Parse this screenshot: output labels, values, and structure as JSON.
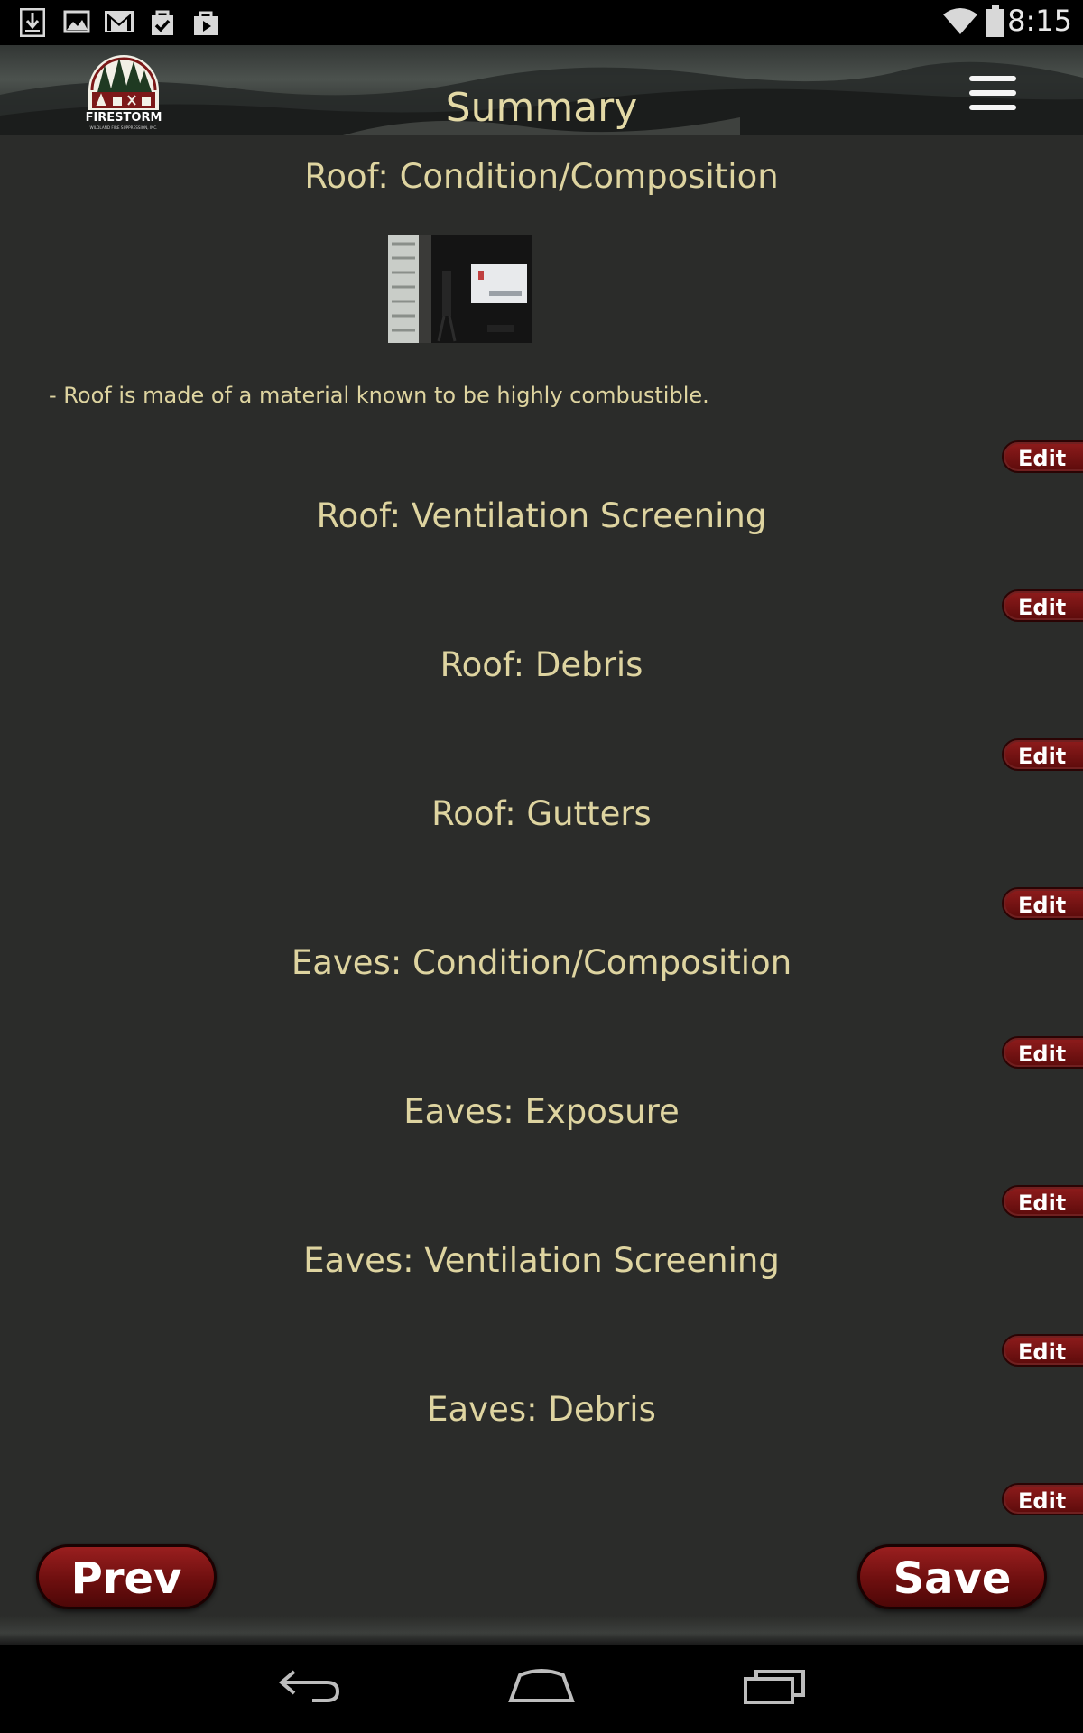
{
  "status_bar": {
    "time": "8:15",
    "left_icons": [
      "download-icon",
      "image-icon",
      "gmail-icon",
      "tasks-icon",
      "play-store-icon"
    ],
    "right_icons": [
      "wifi-icon",
      "battery-icon"
    ]
  },
  "header": {
    "title": "Summary",
    "logo_text": "FIRESTORM",
    "logo_subtext": "WILDLAND FIRE SUPPRESSION, INC."
  },
  "sections": [
    {
      "title": "Roof: Condition/Composition",
      "note": "- Roof is made of a material known to be highly combustible.",
      "has_photo": true,
      "edit_label": "Edit"
    },
    {
      "title": "Roof: Ventilation Screening",
      "edit_label": "Edit"
    },
    {
      "title": "Roof: Debris",
      "edit_label": "Edit"
    },
    {
      "title": "Roof: Gutters",
      "edit_label": "Edit"
    },
    {
      "title": "Eaves: Condition/Composition",
      "edit_label": "Edit"
    },
    {
      "title": "Eaves: Exposure",
      "edit_label": "Edit"
    },
    {
      "title": "Eaves: Ventilation Screening",
      "edit_label": "Edit"
    },
    {
      "title": "Eaves: Debris",
      "edit_label": "Edit"
    }
  ],
  "footer": {
    "prev_label": "Prev",
    "save_label": "Save"
  },
  "nav_bar": [
    "back-icon",
    "home-icon",
    "recents-icon"
  ],
  "colors": {
    "background": "#2b2c2a",
    "text": "#ded4a0",
    "button": "#7a1414"
  }
}
